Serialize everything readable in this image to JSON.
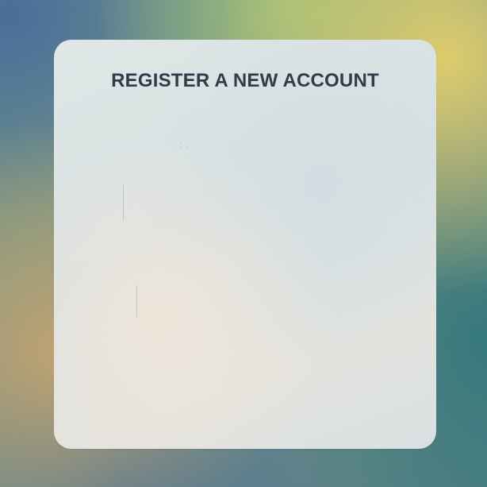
{
  "form": {
    "title": "REGISTER A NEW ACCOUNT"
  }
}
